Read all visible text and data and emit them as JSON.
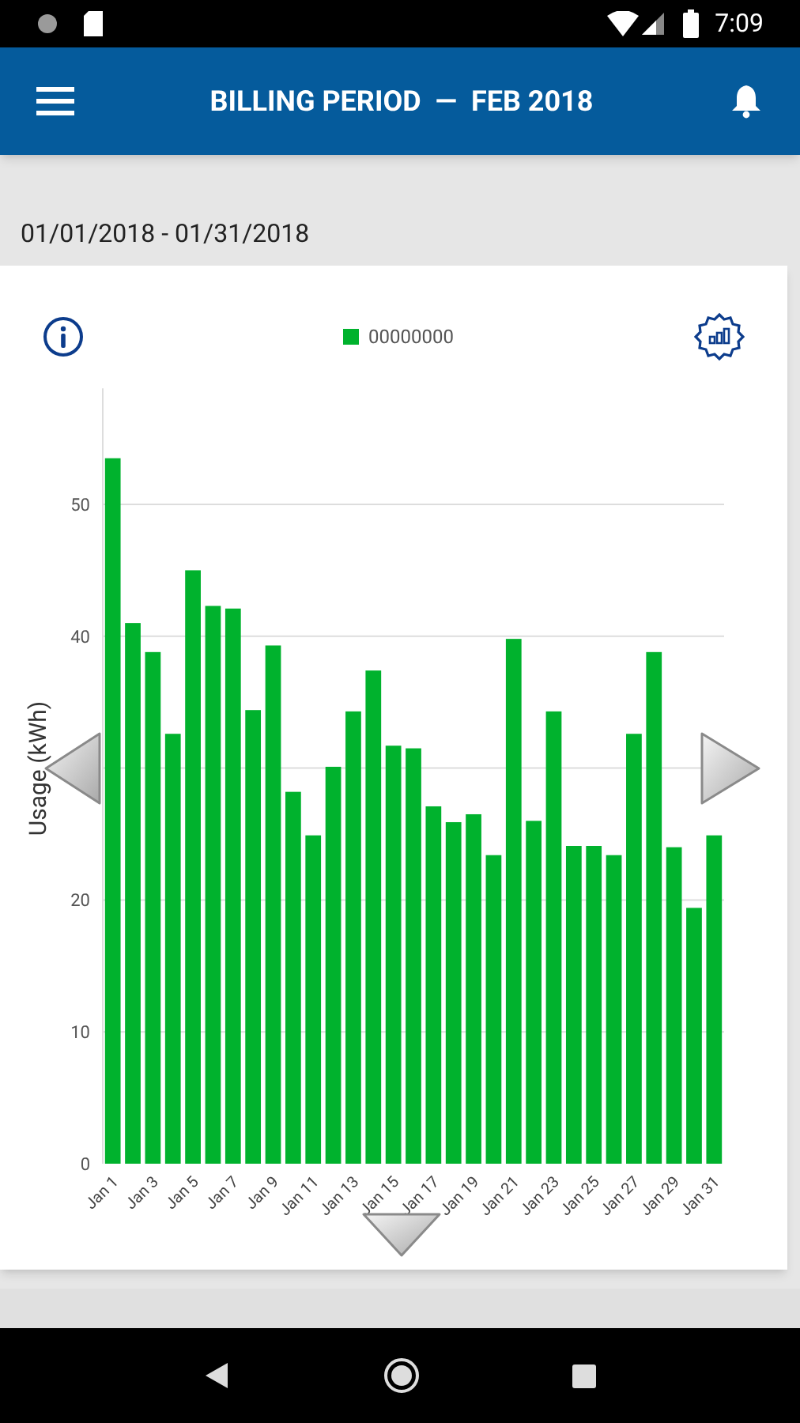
{
  "status_bar": {
    "time": "7:09"
  },
  "app_bar": {
    "title": "BILLING PERIOD  —  FEB 2018"
  },
  "period": {
    "range": "01/01/2018 - 01/31/2018"
  },
  "usage_card": {
    "chart_data": {
      "type": "bar",
      "ylabel": "Usage (kWh)",
      "ylim": [
        0,
        58.8
      ],
      "yticks": [
        0,
        10,
        20,
        40,
        50
      ],
      "grid": true,
      "categories": [
        "Jan 1",
        null,
        "Jan 3",
        null,
        "Jan 5",
        null,
        "Jan 7",
        null,
        "Jan 9",
        null,
        "Jan 11",
        null,
        "Jan 13",
        null,
        "Jan 15",
        null,
        "Jan 17",
        null,
        "Jan 19",
        null,
        "Jan 21",
        null,
        "Jan 23",
        null,
        "Jan 25",
        null,
        "Jan 27",
        null,
        "Jan 29",
        null,
        "Jan 31"
      ],
      "series": [
        {
          "name": "00000000",
          "color": "#00b22d",
          "values": [
            53.5,
            41.0,
            38.8,
            32.6,
            45.0,
            42.3,
            42.1,
            34.4,
            39.3,
            28.2,
            24.9,
            30.1,
            34.3,
            37.4,
            31.7,
            31.5,
            27.1,
            25.9,
            26.5,
            23.4,
            39.8,
            26.0,
            34.3,
            24.1,
            24.1,
            23.4,
            32.6,
            38.8,
            24.0,
            19.4,
            24.9
          ]
        }
      ]
    }
  }
}
